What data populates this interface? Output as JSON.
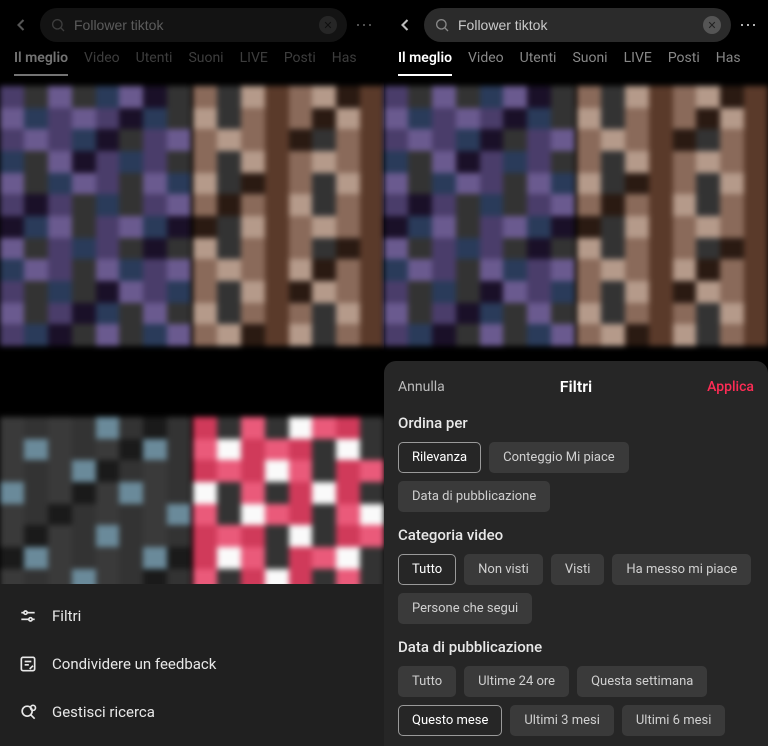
{
  "search": {
    "value": "Follower tiktok"
  },
  "tabs": [
    "Il meglio",
    "Video",
    "Utenti",
    "Suoni",
    "LIVE",
    "Posti",
    "Has"
  ],
  "menu": {
    "filters": "Filtri",
    "feedback": "Condividere un feedback",
    "manage": "Gestisci ricerca"
  },
  "sheet": {
    "cancel": "Annulla",
    "title": "Filtri",
    "apply": "Applica",
    "sort": {
      "title": "Ordina per",
      "options": [
        "Rilevanza",
        "Conteggio Mi piace",
        "Data di pubblicazione"
      ],
      "selected": 0
    },
    "category": {
      "title": "Categoria video",
      "options": [
        "Tutto",
        "Non visti",
        "Visti",
        "Ha messo mi piace",
        "Persone che segui"
      ],
      "selected": 0
    },
    "date": {
      "title": "Data di pubblicazione",
      "options": [
        "Tutto",
        "Ultime 24 ore",
        "Questa settimana",
        "Questo mese",
        "Ultimi 3 mesi",
        "Ultimi 6 mesi"
      ],
      "selected": 3
    }
  }
}
